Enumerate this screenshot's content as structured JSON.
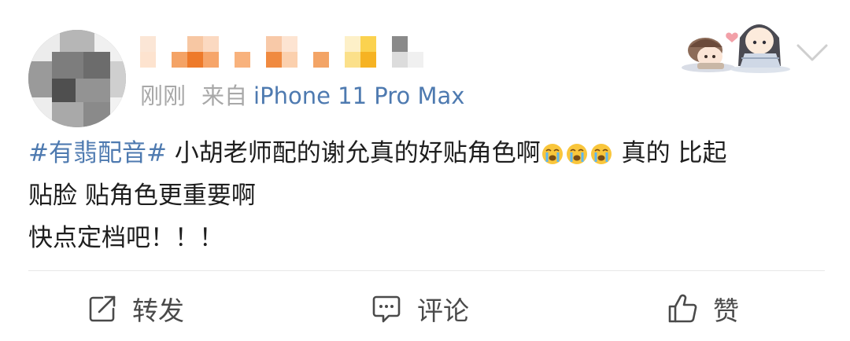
{
  "header": {
    "time": "刚刚",
    "from_label": "来自",
    "device": "iPhone 11 Pro Max"
  },
  "content": {
    "hashtag": "#有翡配音#",
    "line1_text": " 小胡老师配的谢允真的好贴角色啊",
    "line1_tail": " 真的 比起",
    "line2": "贴脸 贴角色更重要啊",
    "line3": "快点定档吧！！！",
    "emoji_name": "crying-face-icon"
  },
  "actions": {
    "repost": "转发",
    "comment": "评论",
    "like": "赞"
  },
  "colors": {
    "link": "#4e7ab0",
    "meta_gray": "#a8a8a8",
    "action_gray": "#4a4a4a",
    "divider": "#e8e8e8"
  }
}
